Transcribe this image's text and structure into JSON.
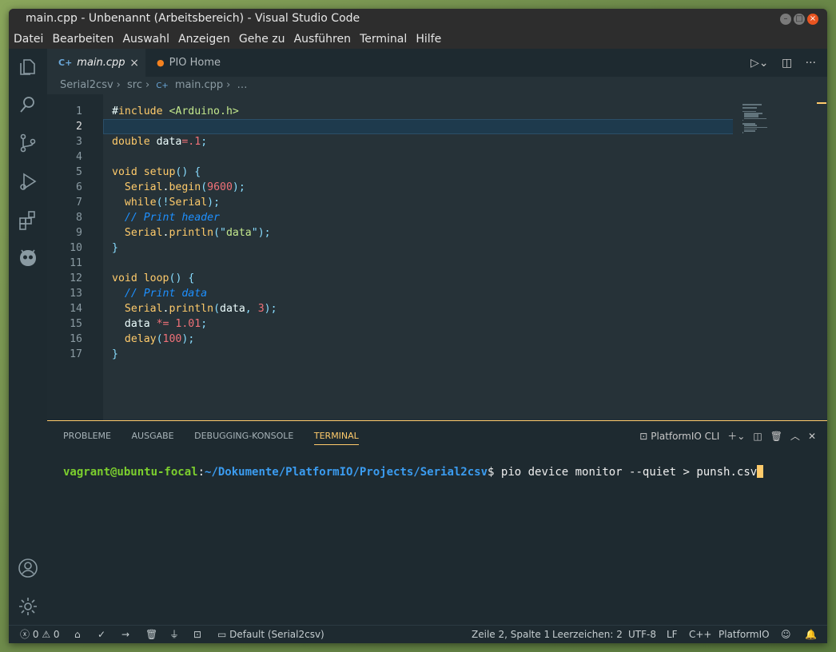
{
  "window": {
    "title": "main.cpp - Unbenannt (Arbeitsbereich) - Visual Studio Code"
  },
  "menu": [
    "Datei",
    "Bearbeiten",
    "Auswahl",
    "Anzeigen",
    "Gehe zu",
    "Ausführen",
    "Terminal",
    "Hilfe"
  ],
  "tabs": [
    {
      "label": "main.cpp",
      "icon": "c++-file-icon",
      "active": true
    },
    {
      "label": "PIO Home",
      "icon": "platformio-icon",
      "active": false
    }
  ],
  "breadcrumbs": [
    "Serial2csv",
    "src",
    "main.cpp",
    "…"
  ],
  "editor": {
    "line_numbers": [
      "1",
      "2",
      "3",
      "4",
      "5",
      "6",
      "7",
      "8",
      "9",
      "10",
      "11",
      "12",
      "13",
      "14",
      "15",
      "16",
      "17"
    ],
    "current_line": 2,
    "lines": [
      "#include <Arduino.h>",
      "",
      "double data=.1;",
      "",
      "void setup() {",
      "  Serial.begin(9600);",
      "  while(!Serial);",
      "  // Print header",
      "  Serial.println(\"data\");",
      "}",
      "",
      "void loop() {",
      "  // Print data",
      "  Serial.println(data, 3);",
      "  data *= 1.01;",
      "  delay(100);",
      "}"
    ]
  },
  "panel": {
    "tabs": [
      "PROBLEME",
      "AUSGABE",
      "DEBUGGING-KONSOLE",
      "TERMINAL"
    ],
    "active_tab": "TERMINAL",
    "terminal_selector": "PlatformIO CLI",
    "prompt_user": "vagrant@ubuntu-focal",
    "prompt_sep": ":",
    "prompt_path": "~/Dokumente/PlatformIO/Projects/Serial2csv",
    "prompt_symbol": "$ ",
    "command": "pio device monitor --quiet > punsh.csv"
  },
  "status": {
    "errors": "0",
    "warnings": "0",
    "env": "Default (Serial2csv)",
    "position": "Zeile 2, Spalte 1",
    "indent": "Leerzeichen: 2",
    "encoding": "UTF-8",
    "eol": "LF",
    "language": "C++",
    "platform": "PlatformIO"
  },
  "colors": {
    "accent": "#ffcb6b",
    "background": "#263238",
    "ubuntu_close": "#e95420"
  }
}
